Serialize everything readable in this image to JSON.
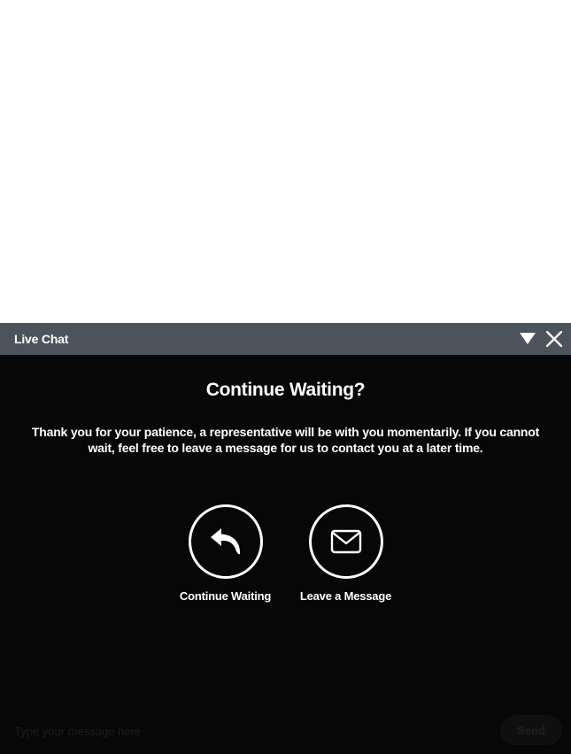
{
  "chat": {
    "title": "Live Chat",
    "dialog": {
      "heading": "Continue Waiting?",
      "message": "Thank you for your patience, a representative will be with you momentarily. If you cannot wait, feel free to leave a message for us to contact you at a later time.",
      "options": [
        {
          "label": "Continue Waiting",
          "icon": "reply-arrow-icon"
        },
        {
          "label": "Leave a Message",
          "icon": "envelope-icon"
        }
      ]
    },
    "composer": {
      "placeholder": "Type your message here",
      "send_label": "Send"
    }
  },
  "colors": {
    "header_bg": "#4d535a",
    "body_bg": "#070707",
    "text": "#ffffff"
  }
}
